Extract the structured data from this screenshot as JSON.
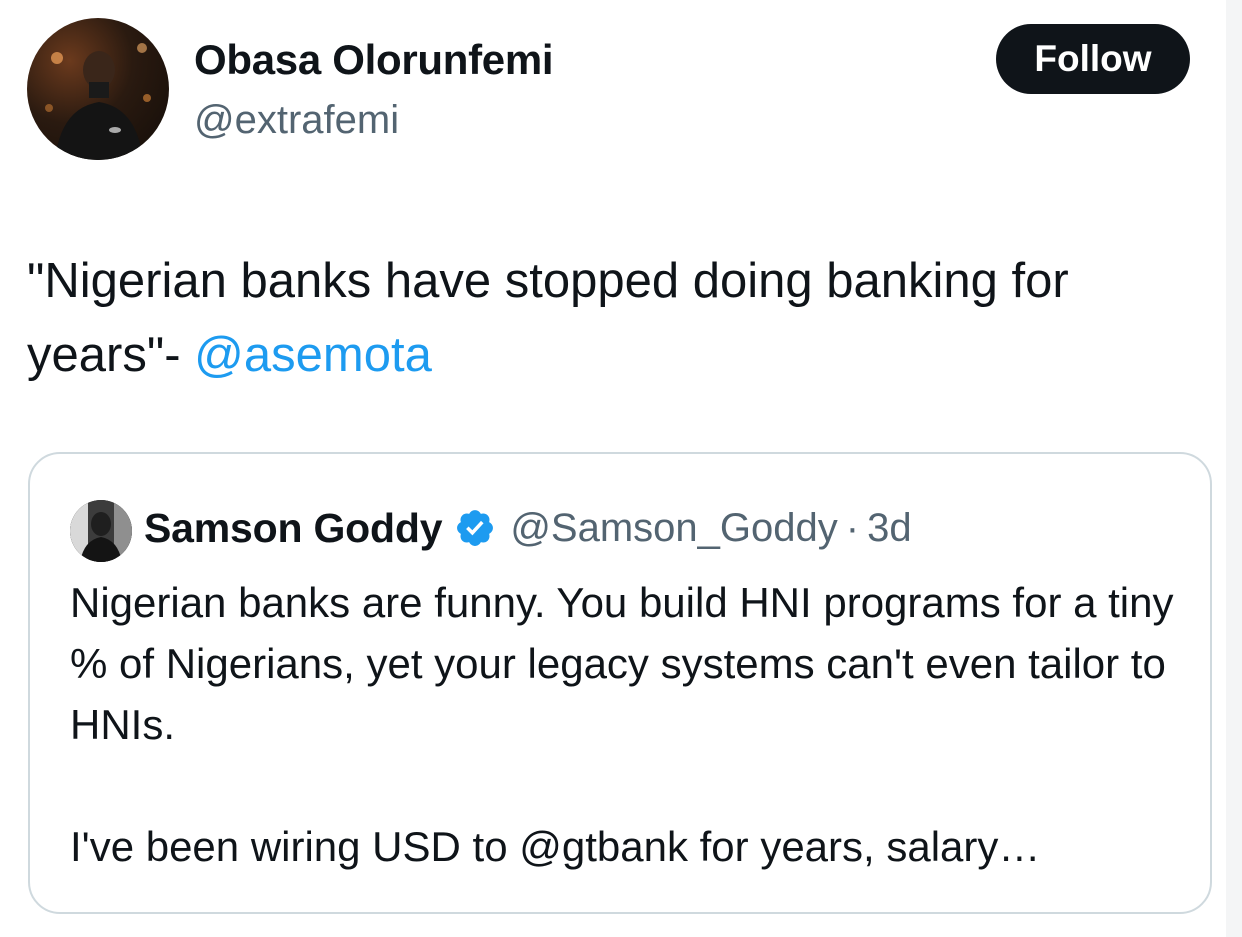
{
  "tweet": {
    "author_name": "Obasa Olorunfemi",
    "author_handle": "@extrafemi",
    "follow_label": "Follow",
    "text": "\"Nigerian banks have stopped doing banking for years\"- ",
    "mention": "@asemota"
  },
  "quote": {
    "author_name": "Samson Goddy",
    "author_handle": "@Samson_Goddy",
    "separator": "·",
    "time": "3d",
    "paragraph_1": "Nigerian banks are funny. You build HNI programs for a tiny % of Nigerians, yet your legacy systems can't even tailor to HNIs.",
    "paragraph_2": "I've been wiring USD to @gtbank for years, salary…"
  },
  "colors": {
    "text": "#0f1419",
    "secondary": "#536471",
    "link": "#1d9bf0",
    "verified": "#1d9bf0",
    "border": "#cfd9de",
    "button": "#0f1419"
  },
  "icons": {
    "avatar": "profile-photo-avatar",
    "quote_avatar": "profile-photo-avatar",
    "verified": "verified-badge-icon"
  }
}
